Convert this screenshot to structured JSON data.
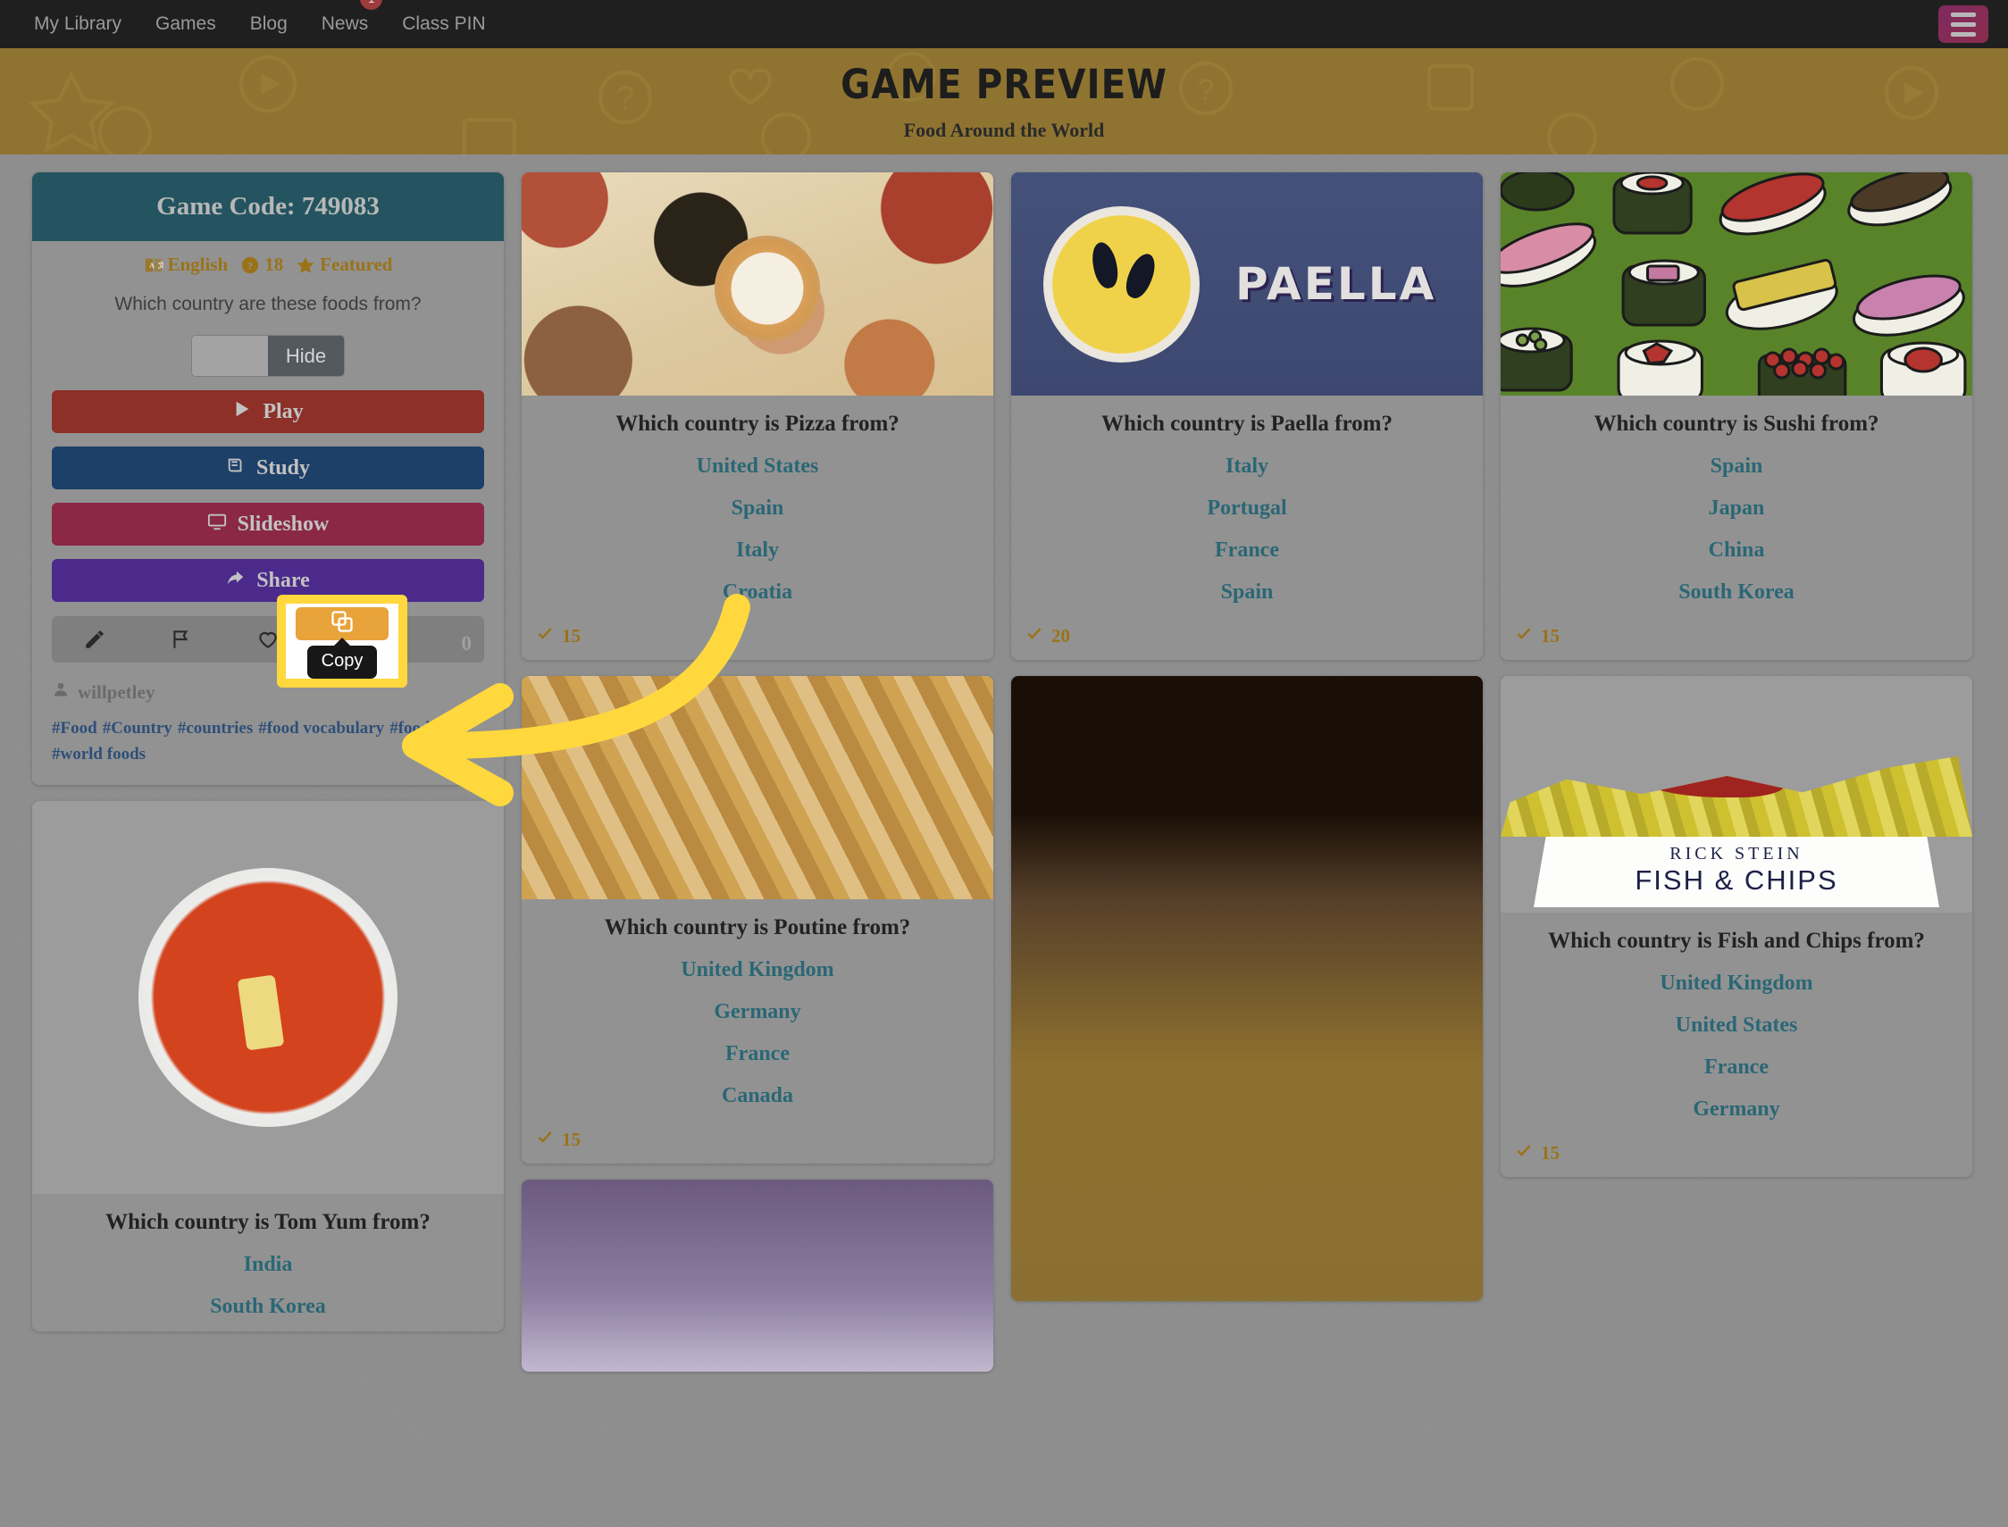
{
  "nav": {
    "links": [
      {
        "label": "My Library",
        "badge": null
      },
      {
        "label": "Games",
        "badge": null
      },
      {
        "label": "Blog",
        "badge": null
      },
      {
        "label": "News",
        "badge": "1"
      },
      {
        "label": "Class PIN",
        "badge": null
      }
    ],
    "menu_icon": "hamburger-icon"
  },
  "hero": {
    "title": "Game Preview",
    "subtitle": "Food Around the World"
  },
  "info_card": {
    "game_code_label": "Game Code: 749083",
    "meta": {
      "language": "English",
      "question_count": "18",
      "featured_label": "Featured"
    },
    "prompt": "Which country are these foods from?",
    "toggle_label": "Hide",
    "buttons": {
      "play": "Play",
      "study": "Study",
      "slideshow": "Slideshow",
      "share": "Share"
    },
    "icon_bar": [
      {
        "name": "edit-icon"
      },
      {
        "name": "flag-icon"
      },
      {
        "name": "heart-icon"
      },
      {
        "name": "folder-icon"
      },
      {
        "name": "copy-icon"
      }
    ],
    "copy_tooltip": "Copy",
    "hidden_count": "0",
    "author": "willpetley",
    "tags": [
      "#Food",
      "#Country",
      "#countries",
      "#food vocabulary",
      "#foods",
      "#world foods"
    ]
  },
  "colors": {
    "nav_bg": "#1f1f1f",
    "hero_bg": "#8f7431",
    "page_bg": "#8d8d8d",
    "card_bg": "#929292",
    "teal_header": "#23545f",
    "answer_teal": "#2a6775",
    "gold": "#9a7319",
    "highlight_yellow": "#ffd83d",
    "copy_orange": "#e8a33a",
    "play_red": "#8c3028",
    "study_blue": "#1d4068",
    "slideshow_maroon": "#8a2846",
    "share_purple": "#4b2a8c",
    "badge_red": "#9c3c3c",
    "hamburger_magenta": "#8c2c4e"
  },
  "cards": [
    {
      "id": "pizza",
      "image": "pizza-photo",
      "question": "Which country is Pizza from?",
      "answers": [
        "United States",
        "Spain",
        "Italy",
        "Croatia"
      ],
      "plays": "15"
    },
    {
      "id": "paella",
      "image": "paella-illustration",
      "image_text": "PAELLA",
      "question": "Which country is Paella from?",
      "answers": [
        "Italy",
        "Portugal",
        "France",
        "Spain"
      ],
      "plays": "20"
    },
    {
      "id": "sushi",
      "image": "sushi-pattern",
      "question": "Which country is Sushi from?",
      "answers": [
        "Spain",
        "Japan",
        "China",
        "South Korea"
      ],
      "plays": "15"
    },
    {
      "id": "tomyum",
      "image": "tomyum-photo",
      "question": "Which country is Tom Yum from?",
      "answers": [
        "India",
        "South Korea"
      ],
      "plays": ""
    },
    {
      "id": "poutine",
      "image": "poutine-photo",
      "question": "Which country is Poutine from?",
      "answers": [
        "United Kingdom",
        "Germany",
        "France",
        "Canada"
      ],
      "plays": "15"
    },
    {
      "id": "fondue",
      "image": "fondue-photo",
      "question": "",
      "answers": [],
      "plays": ""
    },
    {
      "id": "fishchips",
      "image": "fish-and-chips-logo",
      "image_brand": "RICK STEIN",
      "image_main": "FISH & CHIPS",
      "question": "Which country is Fish and Chips from?",
      "answers": [
        "United Kingdom",
        "United States",
        "France",
        "Germany"
      ],
      "plays": "15"
    },
    {
      "id": "partial",
      "image": "partial-photo",
      "question": "",
      "answers": [],
      "plays": ""
    }
  ],
  "annotation": {
    "arrow": "yellow-curved-arrow",
    "arrow_color": "#ffd83d"
  }
}
